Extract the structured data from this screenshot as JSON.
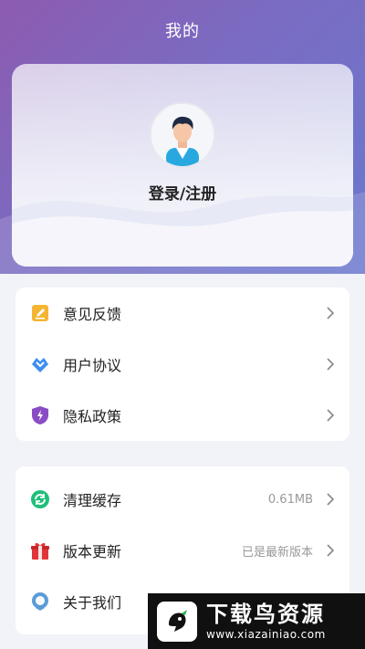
{
  "header": {
    "title": "我的"
  },
  "profile": {
    "login_label": "登录/注册"
  },
  "menu_group_1": [
    {
      "label": "意见反馈",
      "icon": "pencil-note-icon",
      "color": "#f5b533"
    },
    {
      "label": "用户协议",
      "icon": "handshake-icon",
      "color": "#3d8ef0"
    },
    {
      "label": "隐私政策",
      "icon": "shield-bolt-icon",
      "color": "#8a4cc4"
    }
  ],
  "menu_group_2": [
    {
      "label": "清理缓存",
      "value": "0.61MB",
      "icon": "refresh-icon",
      "color": "#1fbf7a"
    },
    {
      "label": "版本更新",
      "value": "已是最新版本",
      "icon": "gift-box-icon",
      "color": "#e0353b"
    },
    {
      "label": "关于我们",
      "value": "",
      "icon": "chat-bubble-icon",
      "color": "#5a9cd8"
    }
  ],
  "watermark": {
    "title": "下载鸟资源",
    "url": "www.xiazainiao.com"
  }
}
